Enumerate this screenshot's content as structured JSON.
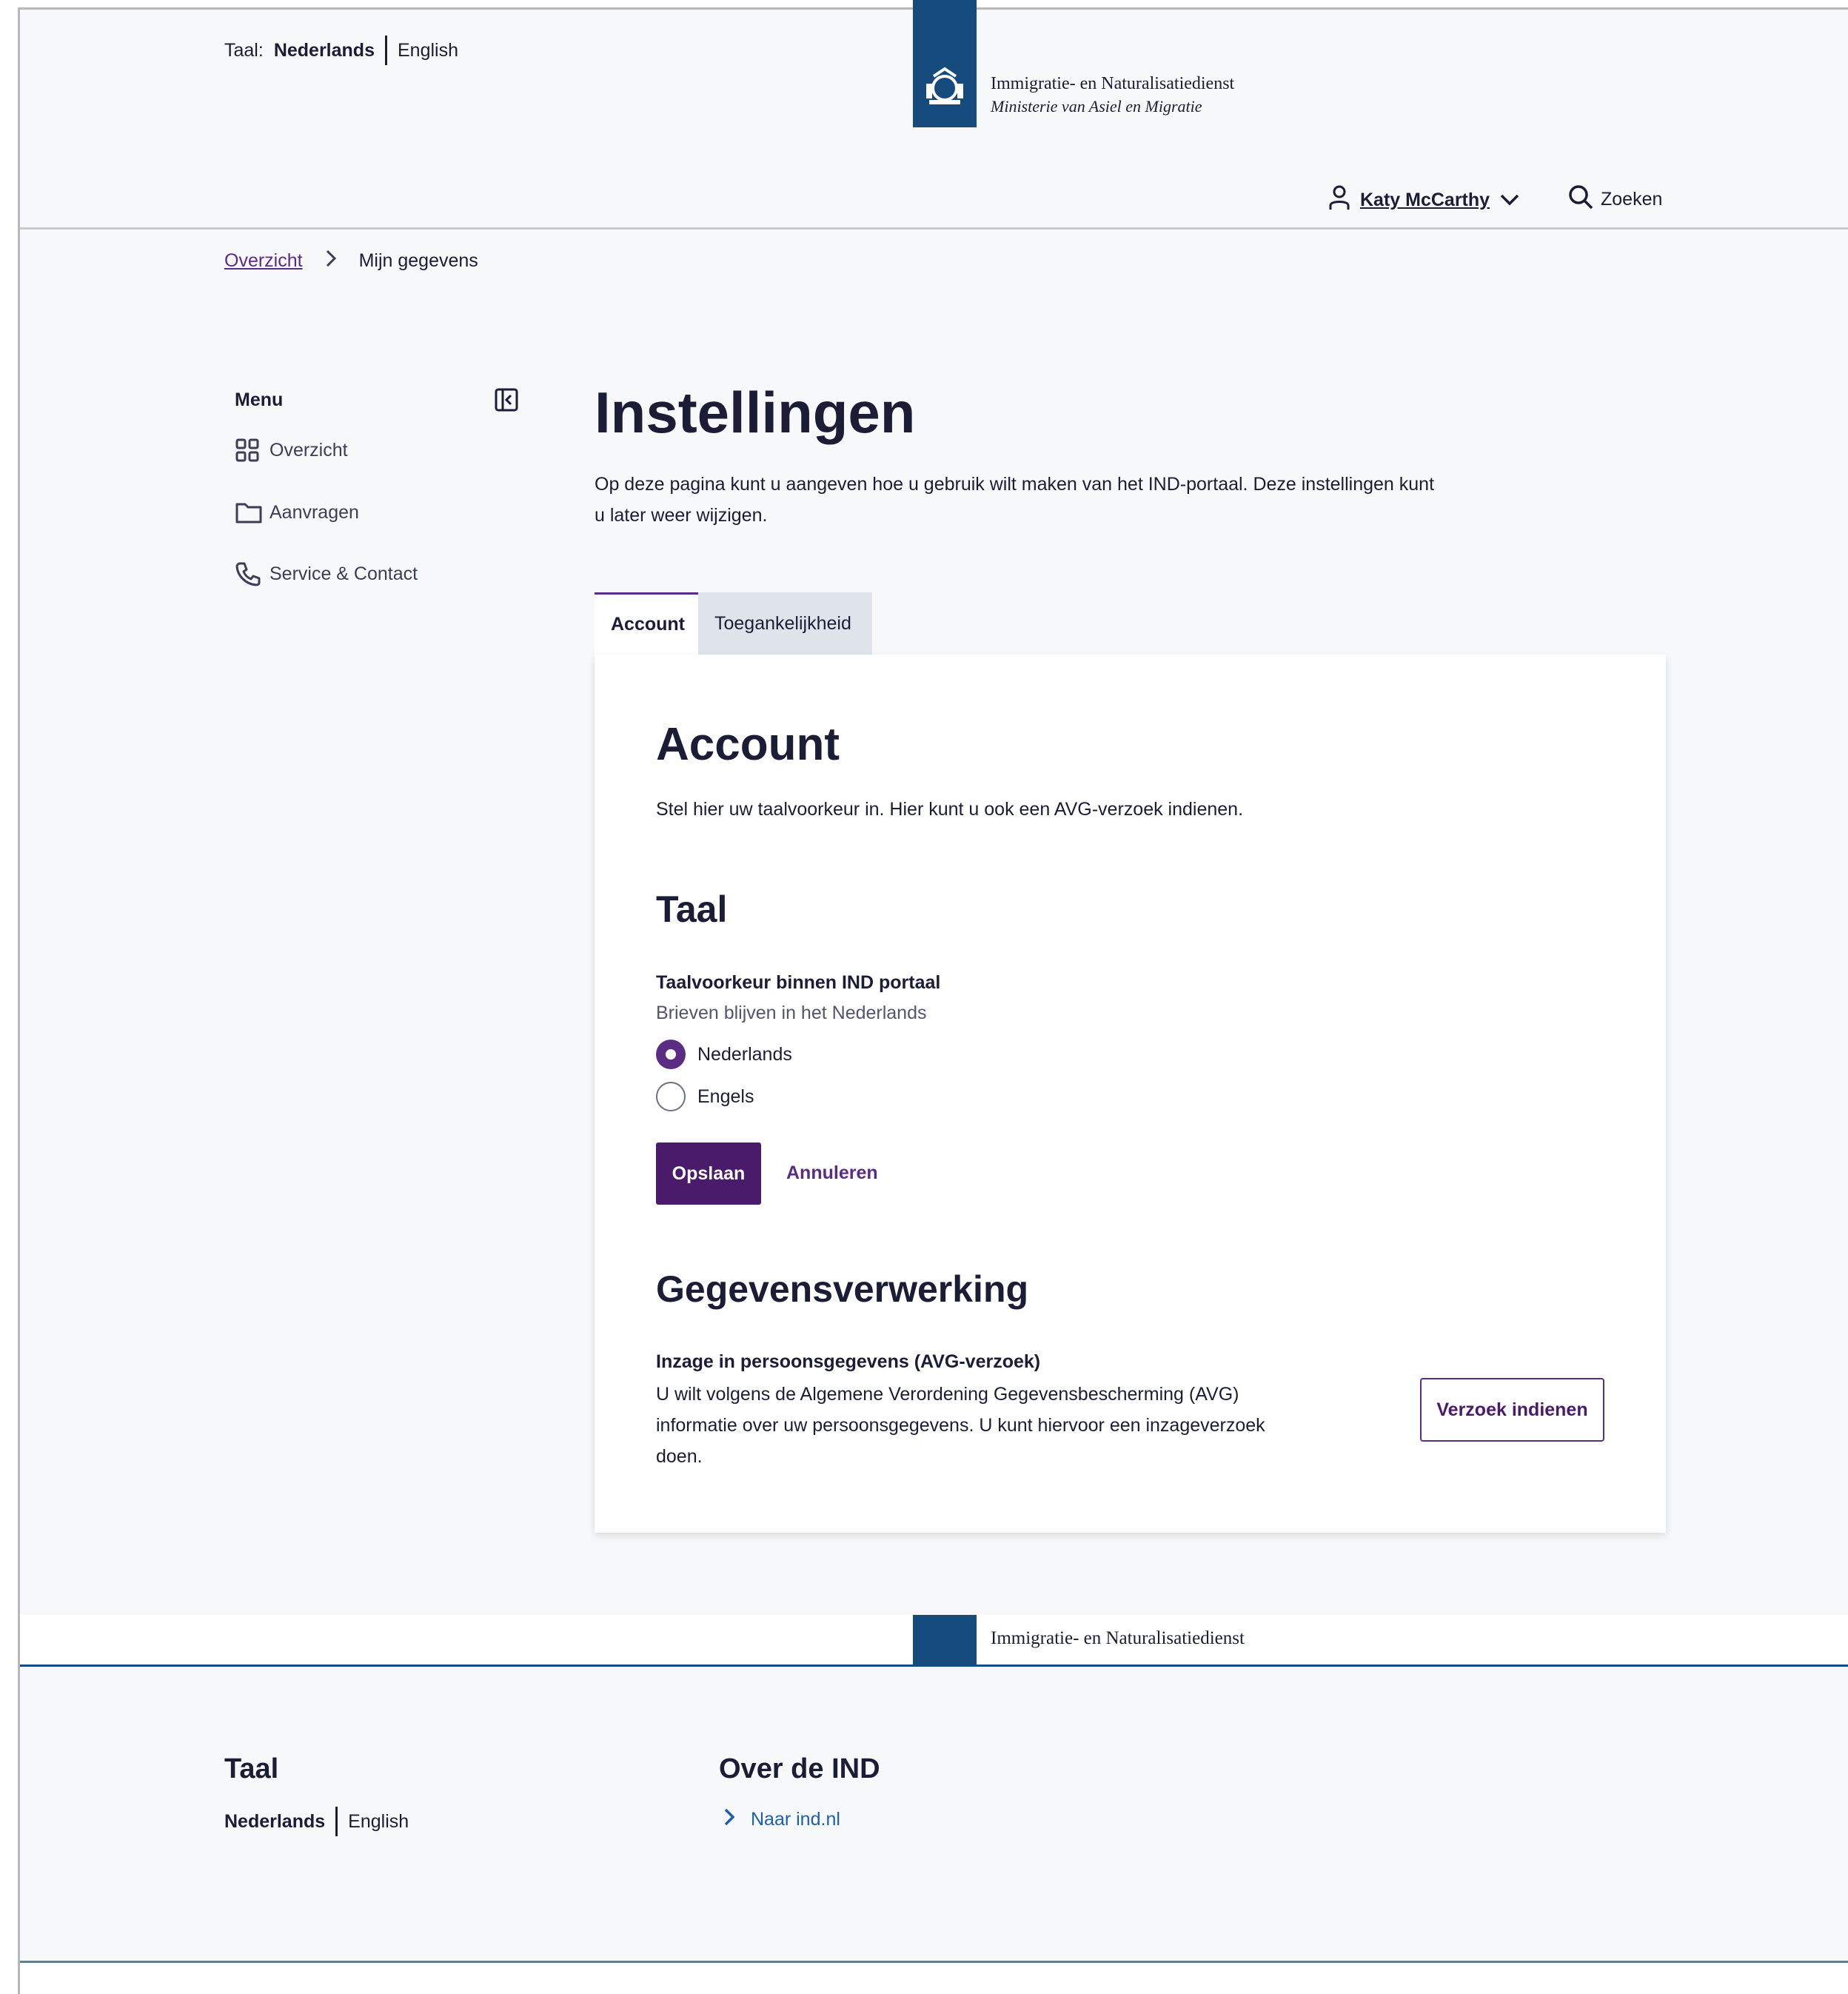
{
  "header": {
    "lang_label": "Taal:",
    "lang_current": "Nederlands",
    "lang_other": "English",
    "org_name": "Immigratie- en Naturalisatiedienst",
    "ministry": "Ministerie van Asiel en Migratie",
    "user_name": "Katy McCarthy",
    "search_label": "Zoeken"
  },
  "breadcrumb": {
    "home": "Overzicht",
    "current": "Mijn gegevens"
  },
  "sidebar": {
    "title": "Menu",
    "items": [
      {
        "label": "Overzicht",
        "icon": "grid-icon"
      },
      {
        "label": "Aanvragen",
        "icon": "folder-icon"
      },
      {
        "label": "Service & Contact",
        "icon": "phone-icon"
      }
    ]
  },
  "main": {
    "title": "Instellingen",
    "intro": "Op deze pagina kunt u aangeven hoe u gebruik wilt maken van het IND-portaal. Deze instellingen kunt u later weer wijzigen.",
    "tabs": [
      {
        "label": "Account",
        "active": true
      },
      {
        "label": "Toegankelijkheid",
        "active": false
      }
    ]
  },
  "account": {
    "heading": "Account",
    "description": "Stel hier uw taalvoorkeur in. Hier kunt u ook een AVG-verzoek indienen.",
    "taal_heading": "Taal",
    "field_label": "Taalvoorkeur binnen IND portaal",
    "field_hint": "Brieven blijven in het Nederlands",
    "options": [
      {
        "label": "Nederlands",
        "selected": true
      },
      {
        "label": "Engels",
        "selected": false
      }
    ],
    "save_label": "Opslaan",
    "cancel_label": "Annuleren",
    "gdpr_heading": "Gegevensverwerking",
    "avg_title": "Inzage in persoonsgegevens (AVG-verzoek)",
    "avg_desc": "U wilt volgens de Algemene Verordening Gegevensbescherming (AVG) informatie over uw persoonsgegevens. U kunt hiervoor een inzageverzoek doen.",
    "avg_button": "Verzoek indienen"
  },
  "footer": {
    "org_name": "Immigratie- en Naturalisatiedienst",
    "taal_heading": "Taal",
    "lang_current": "Nederlands",
    "lang_other": "English",
    "over_heading": "Over de IND",
    "link_label": "Naar ind.nl"
  },
  "colors": {
    "brand_purple": "#4b1b6b",
    "rijks_blue": "#164b7d",
    "link_blue": "#1d5fa8"
  }
}
